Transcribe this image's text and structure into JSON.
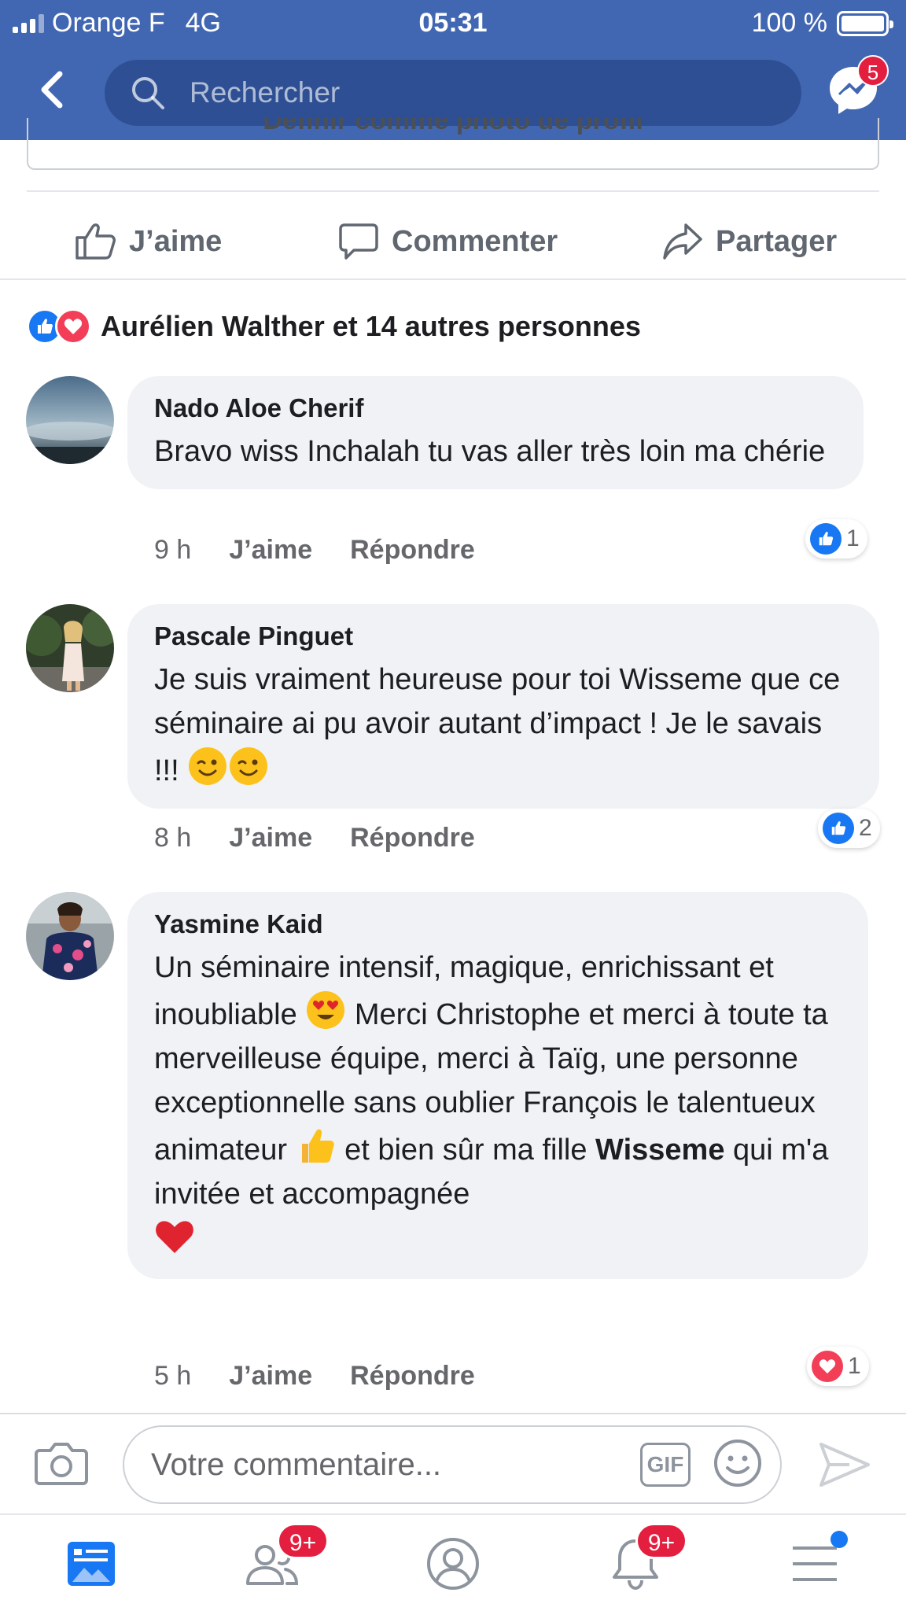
{
  "status_bar": {
    "carrier": "Orange F",
    "network": "4G",
    "time": "05:31",
    "battery": "100 %"
  },
  "header": {
    "search_placeholder": "Rechercher",
    "messenger_badge": "5"
  },
  "post": {
    "profile_button_label": "Définir comme photo de profil",
    "actions": {
      "like": "J’aime",
      "comment": "Commenter",
      "share": "Partager"
    },
    "reactions_summary": "Aurélien Walther et 14 autres personnes"
  },
  "comments": [
    {
      "author": "Nado Aloe Cherif",
      "text": "Bravo wiss Inchalah tu vas aller très loin ma chérie",
      "time": "9 h",
      "like_label": "J’aime",
      "reply_label": "Répondre",
      "reaction_count": "1",
      "reaction_type": "like"
    },
    {
      "author": "Pascale Pinguet",
      "text_line1": "Je suis vraiment heureuse pour toi Wisseme que ce séminaire ai pu avoir autant d’impact",
      "text_line2": "! Je le savais !!!",
      "emoji": "😉😉",
      "time": "8 h",
      "like_label": "J’aime",
      "reply_label": "Répondre",
      "reaction_count": "2",
      "reaction_type": "like"
    },
    {
      "author": "Yasmine Kaid",
      "text_part1": "Un séminaire intensif, magique, enrichissant et inoubliable",
      "text_part2": "Merci Christophe et merci à toute ta merveilleuse équipe, merci à Taïg, une personne exceptionnelle sans oublier François le talentueux animateur",
      "text_part3": "et bien sûr ma fille",
      "mention": "Wisseme",
      "text_part4": "qui m'a invitée  et accompagnée",
      "time": "5 h",
      "like_label": "J’aime",
      "reply_label": "Répondre",
      "reaction_count": "1",
      "reaction_type": "love"
    }
  ],
  "composer": {
    "placeholder": "Votre commentaire...",
    "gif_label": "GIF"
  },
  "tabbar": {
    "friends_badge": "9+",
    "notifications_badge": "9+"
  },
  "colors": {
    "brand_blue": "#4267b2",
    "search_blue": "#2e4f93",
    "like_blue": "#1877f2",
    "love_red": "#f33e58",
    "badge_red": "#e41e3f",
    "bubble_gray": "#f0f2f5"
  },
  "icons": [
    "back-arrow-icon",
    "search-icon",
    "messenger-icon",
    "thumbs-up-icon",
    "comment-icon",
    "share-icon",
    "camera-icon",
    "smiley-icon",
    "send-icon",
    "news-feed-icon",
    "friends-icon",
    "profile-icon",
    "bell-icon",
    "menu-icon"
  ]
}
